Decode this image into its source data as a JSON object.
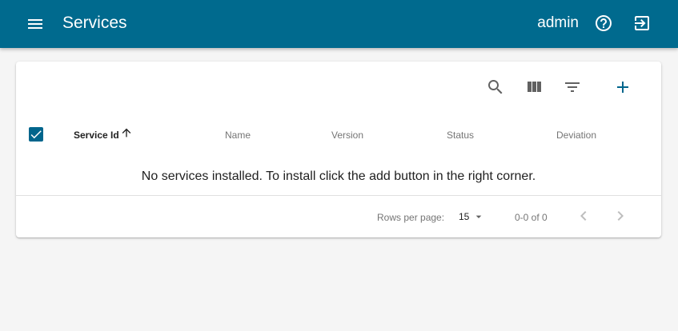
{
  "appbar": {
    "title": "Services",
    "user": "admin",
    "bg_color": "#006a8e",
    "icons": [
      "menu-icon",
      "help-icon",
      "logout-icon"
    ]
  },
  "toolbar": {
    "icons": [
      "search-icon",
      "view-column-icon",
      "filter-list-icon",
      "add-icon"
    ],
    "accent_color": "#00658c"
  },
  "table": {
    "select_all_checked": true,
    "columns": [
      {
        "label": "Service Id",
        "sorted": "asc"
      },
      {
        "label": "Name"
      },
      {
        "label": "Version"
      },
      {
        "label": "Status"
      },
      {
        "label": "Deviation"
      }
    ],
    "empty_message": "No services installed. To install click the add button in the right corner."
  },
  "pagination": {
    "rows_per_page_label": "Rows per page:",
    "rows_per_page": "15",
    "range": "0-0 of 0"
  }
}
